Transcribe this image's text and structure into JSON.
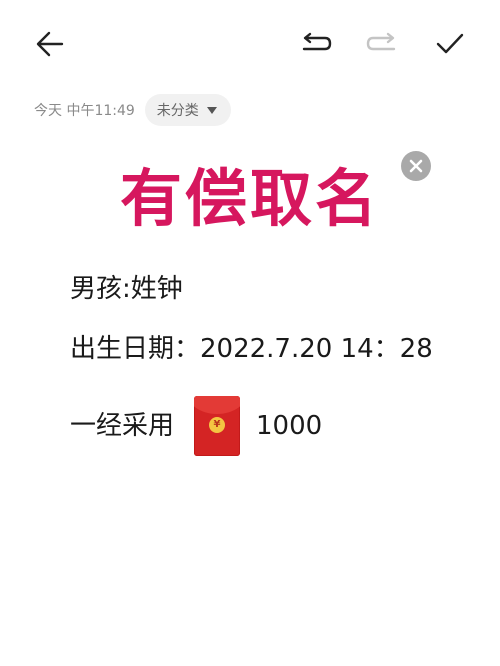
{
  "toolbar": {
    "back_icon": "arrow-left-icon",
    "undo_icon": "undo-icon",
    "redo_icon": "redo-icon",
    "confirm_icon": "checkmark-icon"
  },
  "meta": {
    "timestamp": "今天 中午11:49",
    "category": "未分类"
  },
  "note": {
    "headline": "有偿取名",
    "gender_line": "男孩:姓钟",
    "birth_line": "出生日期：2022.7.20 14：28",
    "reward_label": "一经采用",
    "reward_icon": "red-envelope-icon",
    "reward_coin": "¥",
    "reward_amount": "1000"
  },
  "colors": {
    "headline": "#d6175e",
    "red_packet": "#d42424",
    "chip_bg": "#f1f1f1",
    "close_badge": "#a9a9a9"
  }
}
